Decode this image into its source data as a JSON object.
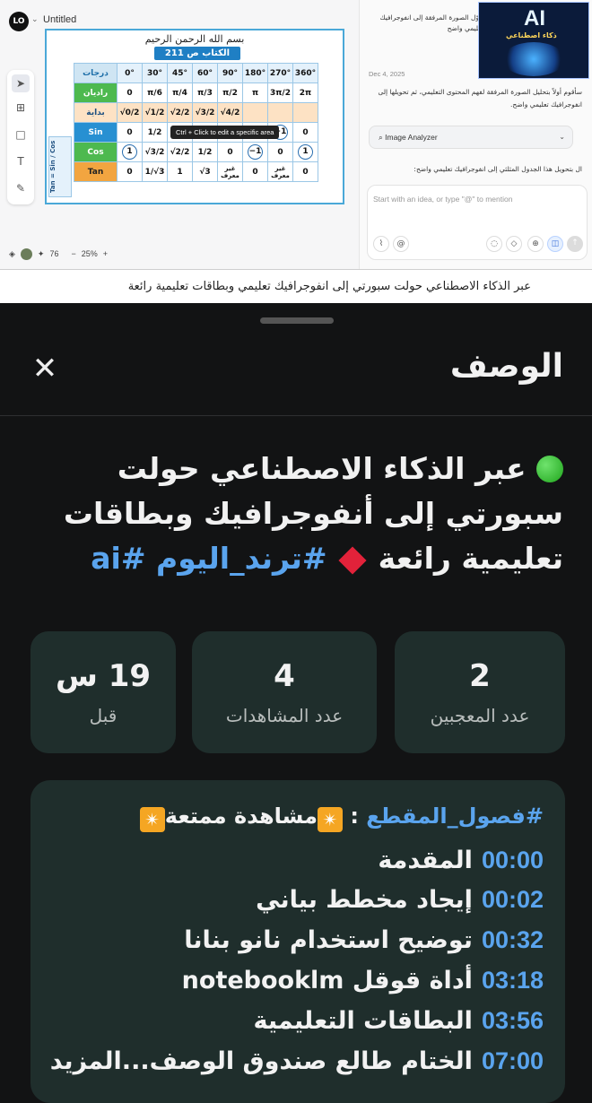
{
  "editor": {
    "logo": "LO",
    "doc_title": "Untitled",
    "zoom": "25%",
    "credits": "76",
    "tooltip": "Ctrl + Click to edit a specific area"
  },
  "table_image": {
    "basmala": "بسم الله الرحمن الرحيم",
    "book_label": "الكتاب ص 211",
    "row_headers": [
      "درجات",
      "راديان",
      "بداية",
      "Sin",
      "Cos",
      "Tan"
    ],
    "degrees": [
      "0°",
      "30°",
      "45°",
      "60°",
      "90°",
      "180°",
      "270°",
      "360°"
    ],
    "radians": [
      "0",
      "π/6",
      "π/4",
      "π/3",
      "π/2",
      "π",
      "3π/2",
      "2π"
    ],
    "start": [
      "√0/2",
      "√1/2",
      "√2/2",
      "√3/2",
      "√4/2"
    ],
    "sin": [
      "0",
      "1/2",
      "√2/2",
      "√3/2",
      "1",
      "0",
      "−1",
      "0"
    ],
    "cos": [
      "1",
      "√3/2",
      "√2/2",
      "1/2",
      "0",
      "−1",
      "0",
      "1"
    ],
    "tan": [
      "0",
      "1/√3",
      "1",
      "√3",
      "غير معرف",
      "0",
      "غير معرف",
      "0"
    ],
    "side_label": "Tan = Sin / Cos"
  },
  "chat": {
    "prompt": "حوّل الصورة المرفقة إلى انفوجرافيك تعليمي واضح",
    "thumb_big": "AI",
    "thumb_sub": "ذكاء اصطناعي",
    "date": "Dec 4, 2025",
    "reply": "سأقوم أولاً بتحليل الصورة المرفقة لفهم المحتوى التعليمي، ثم تحويلها إلى انفوجرافيك تعليمي واضح.",
    "tool_name": "Image Analyzer",
    "reply2": "ال بتحويل هذا الجدول المثلثي إلى انفوجرافيك تعليمي واضح:",
    "input_placeholder": "Start with an idea, or type \"@\" to mention"
  },
  "caption": "عبر الذكاء الاصطناعي حولت سبورتي إلى انفوجرافيك تعليمي وبطاقات تعليمية رائعة",
  "sheet": {
    "title": "الوصف",
    "headline_text": "عبر الذكاء الاصطناعي حولت سبورتي إلى أنفوجرافيك وبطاقات تعليمية رائعة",
    "tags": "#ترند_اليوم #ai",
    "stats": [
      {
        "value": "2",
        "label": "عدد المعجبين"
      },
      {
        "value": "4",
        "label": "عدد المشاهدات"
      },
      {
        "value": "19 س",
        "label": "قبل"
      }
    ],
    "chapters_tag": "#فصول_المقطع",
    "chapters_sep": ":",
    "chapters_title": "مشاهدة ممتعة",
    "chapters": [
      {
        "time": "00:00",
        "label": "المقدمة"
      },
      {
        "time": "00:02",
        "label": "إيجاد مخطط بياني"
      },
      {
        "time": "00:32",
        "label": "توضيح  استخدام نانو بنانا"
      },
      {
        "time": "03:18",
        "label": "أداة قوقل  notebooklm"
      },
      {
        "time": "03:56",
        "label": "البطاقات  التعليمية"
      },
      {
        "time": "07:00",
        "label": "الختام طالع صندوق الوصف...المزيد"
      }
    ]
  }
}
